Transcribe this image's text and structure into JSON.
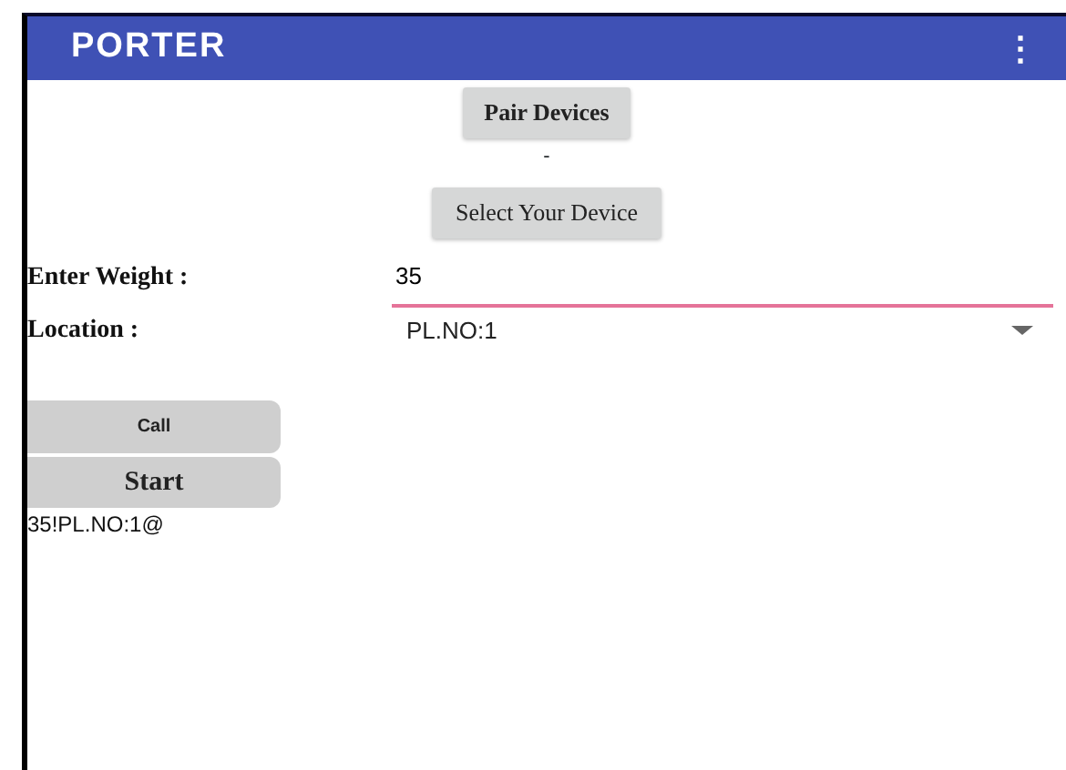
{
  "app_bar": {
    "title": "PORTER",
    "menu_icon": "⋮"
  },
  "pair_button": "Pair Devices",
  "device_status": "-",
  "select_button": "Select Your Device",
  "weight": {
    "label": "Enter Weight  :",
    "value": "35",
    "focused": true
  },
  "location": {
    "label": "Location :",
    "value": "PL.NO:1"
  },
  "call_button": "Call",
  "start_button": "Start",
  "output": "35!PL.NO:1@"
}
